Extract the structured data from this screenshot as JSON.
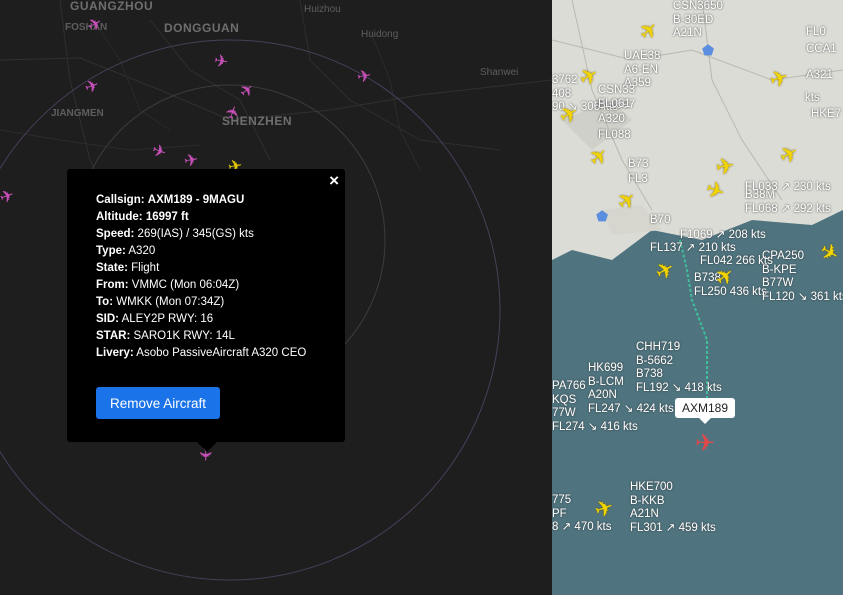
{
  "map_labels": {
    "guangzhou": "GUANGZHOU",
    "foshan": "FOSHAN",
    "dongguan": "DONGGUAN",
    "huizhou": "Huizhou",
    "huidong": "Huidong",
    "shanwei": "Shanwei",
    "jiangmen": "JIANGMEN",
    "shenzhen": "SHENZHEN"
  },
  "popup": {
    "rows": [
      {
        "label": "Callsign:",
        "value": "AXM189 - 9MAGU"
      },
      {
        "label": "Altitude:",
        "value": "16997 ft"
      },
      {
        "label": "Speed:",
        "value": "269(IAS) / 345(GS) kts"
      },
      {
        "label": "Type:",
        "value": "A320"
      },
      {
        "label": "State:",
        "value": "Flight"
      },
      {
        "label": "From:",
        "value": "VMMC (Mon 06:04Z)"
      },
      {
        "label": "To:",
        "value": "WMKK (Mon 07:34Z)"
      },
      {
        "label": "SID:",
        "value": "ALEY2P RWY: 16"
      },
      {
        "label": "STAR:",
        "value": "SARO1K RWY: 14L"
      },
      {
        "label": "Livery:",
        "value": "Asobo PassiveAircraft A320 CEO"
      }
    ],
    "close_label": "×",
    "remove_label": "Remove Aircraft"
  },
  "selected_aircraft": {
    "callout": "AXM189"
  },
  "flight_labels": {
    "chh719": "CHH719\nB-5662\nB738\nFL192 ↘ 418 kts",
    "hke700": "HKE700\nB-KKB\nA21N\nFL301 ↗ 459 kts",
    "cpa250": "CPA250\nB-KPE\nB77W\nFL120 ↘ 361 kts",
    "hk699": "HK699\nB-LCM\nA20N\nFL247 ↘ 424 kts",
    "cpa766": "PA766\nKQS\n77W\nFL274 ↘ 416 kts",
    "l775": "775\nPF\n8 ↗ 470 kts",
    "fl250": "B738\nFL250 436 kts",
    "fl042": "FL042 266 kts",
    "fl137": "FL137 ↗ 210 kts",
    "csn": "CSN3650\nB-30ED\nA21N",
    "cs": "CS\nE",
    "hke7": "HKE7",
    "fl033": "FL033 ↗ 230 kts",
    "fl068": "FL068 ↗ 292 kts",
    "b38m": "B38M",
    "f1069": "F1069 ↗ 208 kts",
    "csn3762": "3762\n408\n90 ↘ 306 kts",
    "uae": "UAE38\nA6-EN\nA359",
    "b1697": "B-1697\nA320",
    "csn33": "CSN33\nFL061",
    "fl088": "FL088",
    "b73": "B73",
    "fl3": "FL3",
    "b70": "B70",
    "kts": "kts",
    "fl0": "FL0",
    "a321": "A321",
    "ccai": "CCA1",
    "hke73": "HKE73"
  },
  "colors": {
    "dark_bg": "#1e1e1e",
    "water": "#4f747f",
    "land": "#dcdcd6",
    "yellow_aircraft": "#f2d400",
    "magenta_aircraft": "#c64fb7",
    "selected_aircraft": "#e0494a",
    "remove_button": "#1a73e8",
    "track": "#3fbf9a"
  },
  "icons": [
    "close-icon",
    "aircraft-icon",
    "airport-pin-icon"
  ]
}
